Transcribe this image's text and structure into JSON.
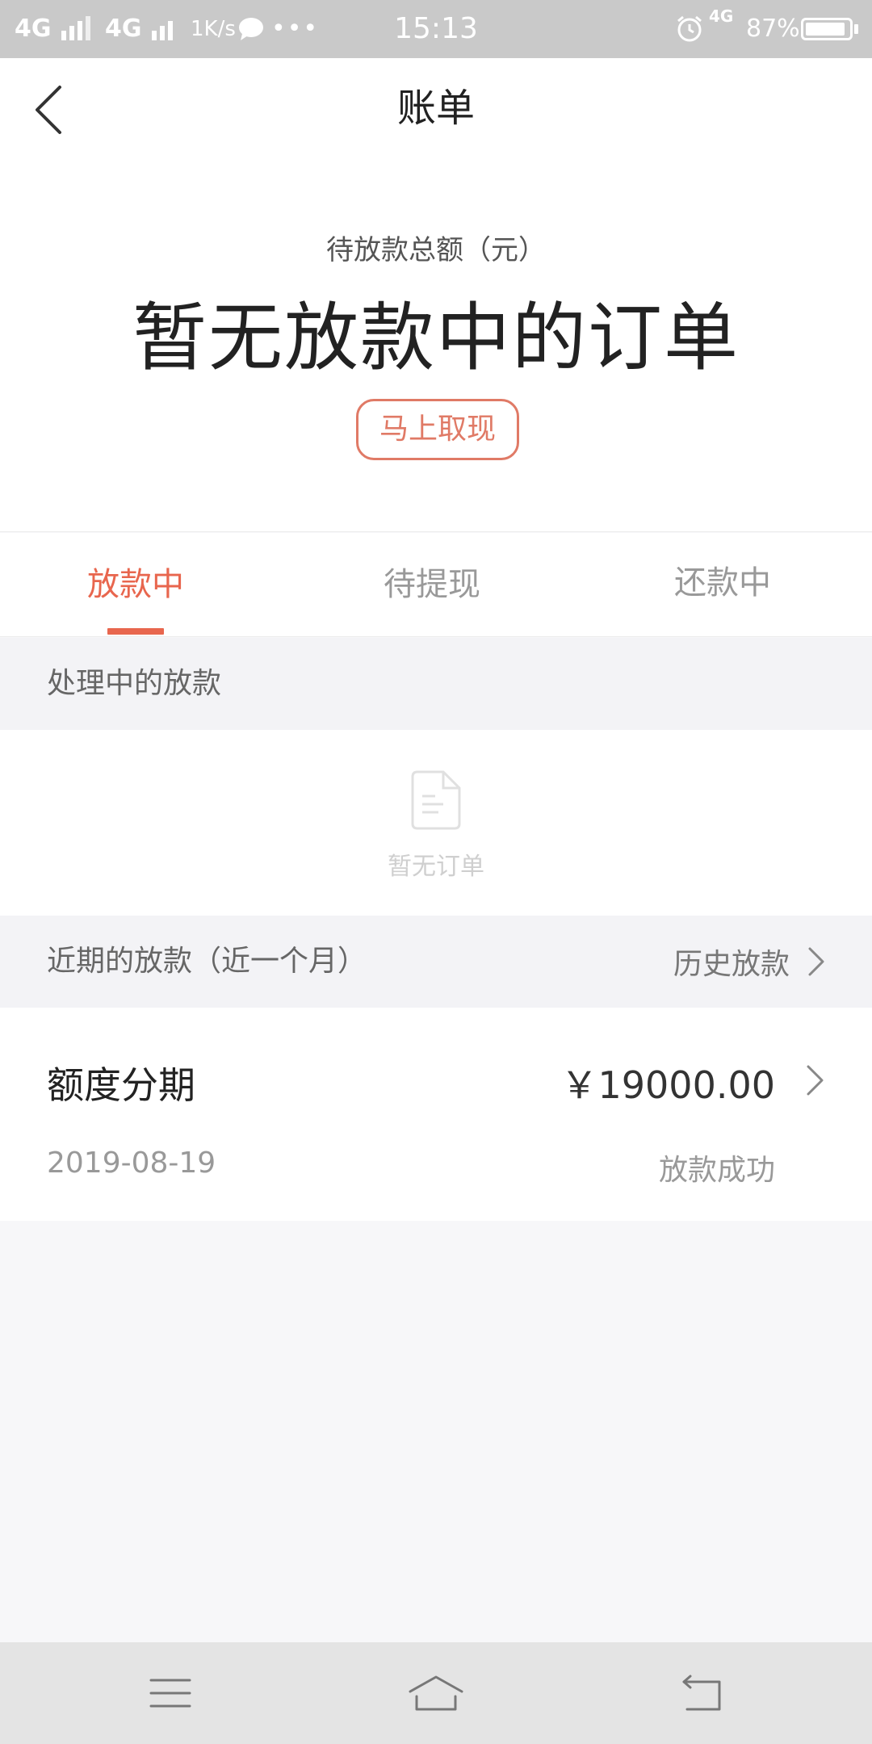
{
  "status_bar": {
    "network1": "4G",
    "network2": "4G",
    "speed": "1K/s",
    "time": "15:13",
    "network3": "4G",
    "battery": "87%"
  },
  "header": {
    "title": "账单"
  },
  "summary": {
    "label": "待放款总额（元）",
    "value": "暂无放款中的订单",
    "withdraw_button": "马上取现"
  },
  "tabs": [
    {
      "label": "放款中",
      "active": true
    },
    {
      "label": "待提现",
      "active": false
    },
    {
      "label": "还款中",
      "active": false
    }
  ],
  "processing": {
    "label": "处理中的放款",
    "empty_text": "暂无订单"
  },
  "recent": {
    "label": "近期的放款（近一个月）",
    "history_link": "历史放款"
  },
  "orders": [
    {
      "name": "额度分期",
      "amount": "￥19000.00",
      "date": "2019-08-19",
      "status": "放款成功"
    }
  ],
  "colors": {
    "accent": "#e8664e",
    "status_bar": "#c9c9c9",
    "section_bg": "#f3f3f6"
  },
  "icons": {
    "back": "chevron-left-icon",
    "chevron": "chevron-right-icon",
    "empty": "document-icon"
  }
}
